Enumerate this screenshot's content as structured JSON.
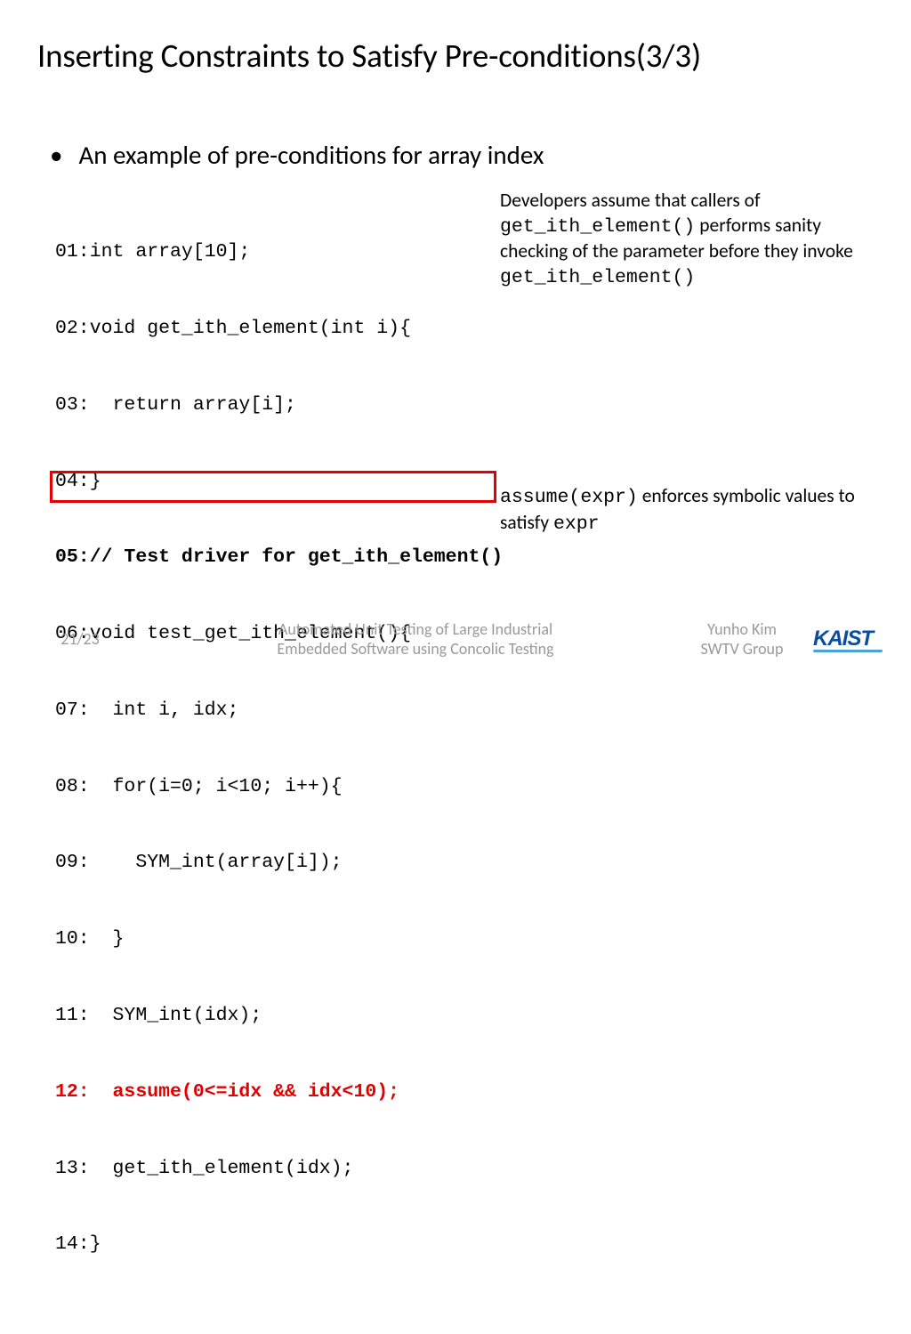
{
  "title": "Inserting Constraints to Satisfy Pre-conditions(3/3)",
  "bullet": "An example of pre-conditions for array index",
  "code": {
    "l01": "01:int array[10];",
    "l02": "02:void get_ith_element(int i){",
    "l03": "03:  return array[i];",
    "l04": "04:}",
    "l05": "05:// Test driver for get_ith_element()",
    "l06": "06:void test_get_ith_element(){",
    "l07": "07:  int i, idx;",
    "l08": "08:  for(i=0; i<10; i++){",
    "l09": "09:    SYM_int(array[i]);",
    "l10": "10:  }",
    "l11": "11:  SYM_int(idx);",
    "l12": "12:  assume(0<=idx && idx<10);",
    "l13": "13:  get_ith_element(idx);",
    "l14": "14:}"
  },
  "note1": {
    "t1": "Developers assume that callers of ",
    "fn1": "get_ith_element()",
    "t2": " performs sanity checking of the parameter before they invoke ",
    "fn2": "get_ith_element()"
  },
  "note2": {
    "fn": "assume(expr)",
    "t1": " enforces symbolic values to satisfy ",
    "expr": "expr"
  },
  "footer": {
    "page": "21/23",
    "talk_line1": "Automated Unit Testing of Large Industrial",
    "talk_line2": "Embedded Software using Concolic Testing",
    "author_line1": "Yunho Kim",
    "author_line2": "SWTV Group",
    "logo": "KAIST"
  }
}
